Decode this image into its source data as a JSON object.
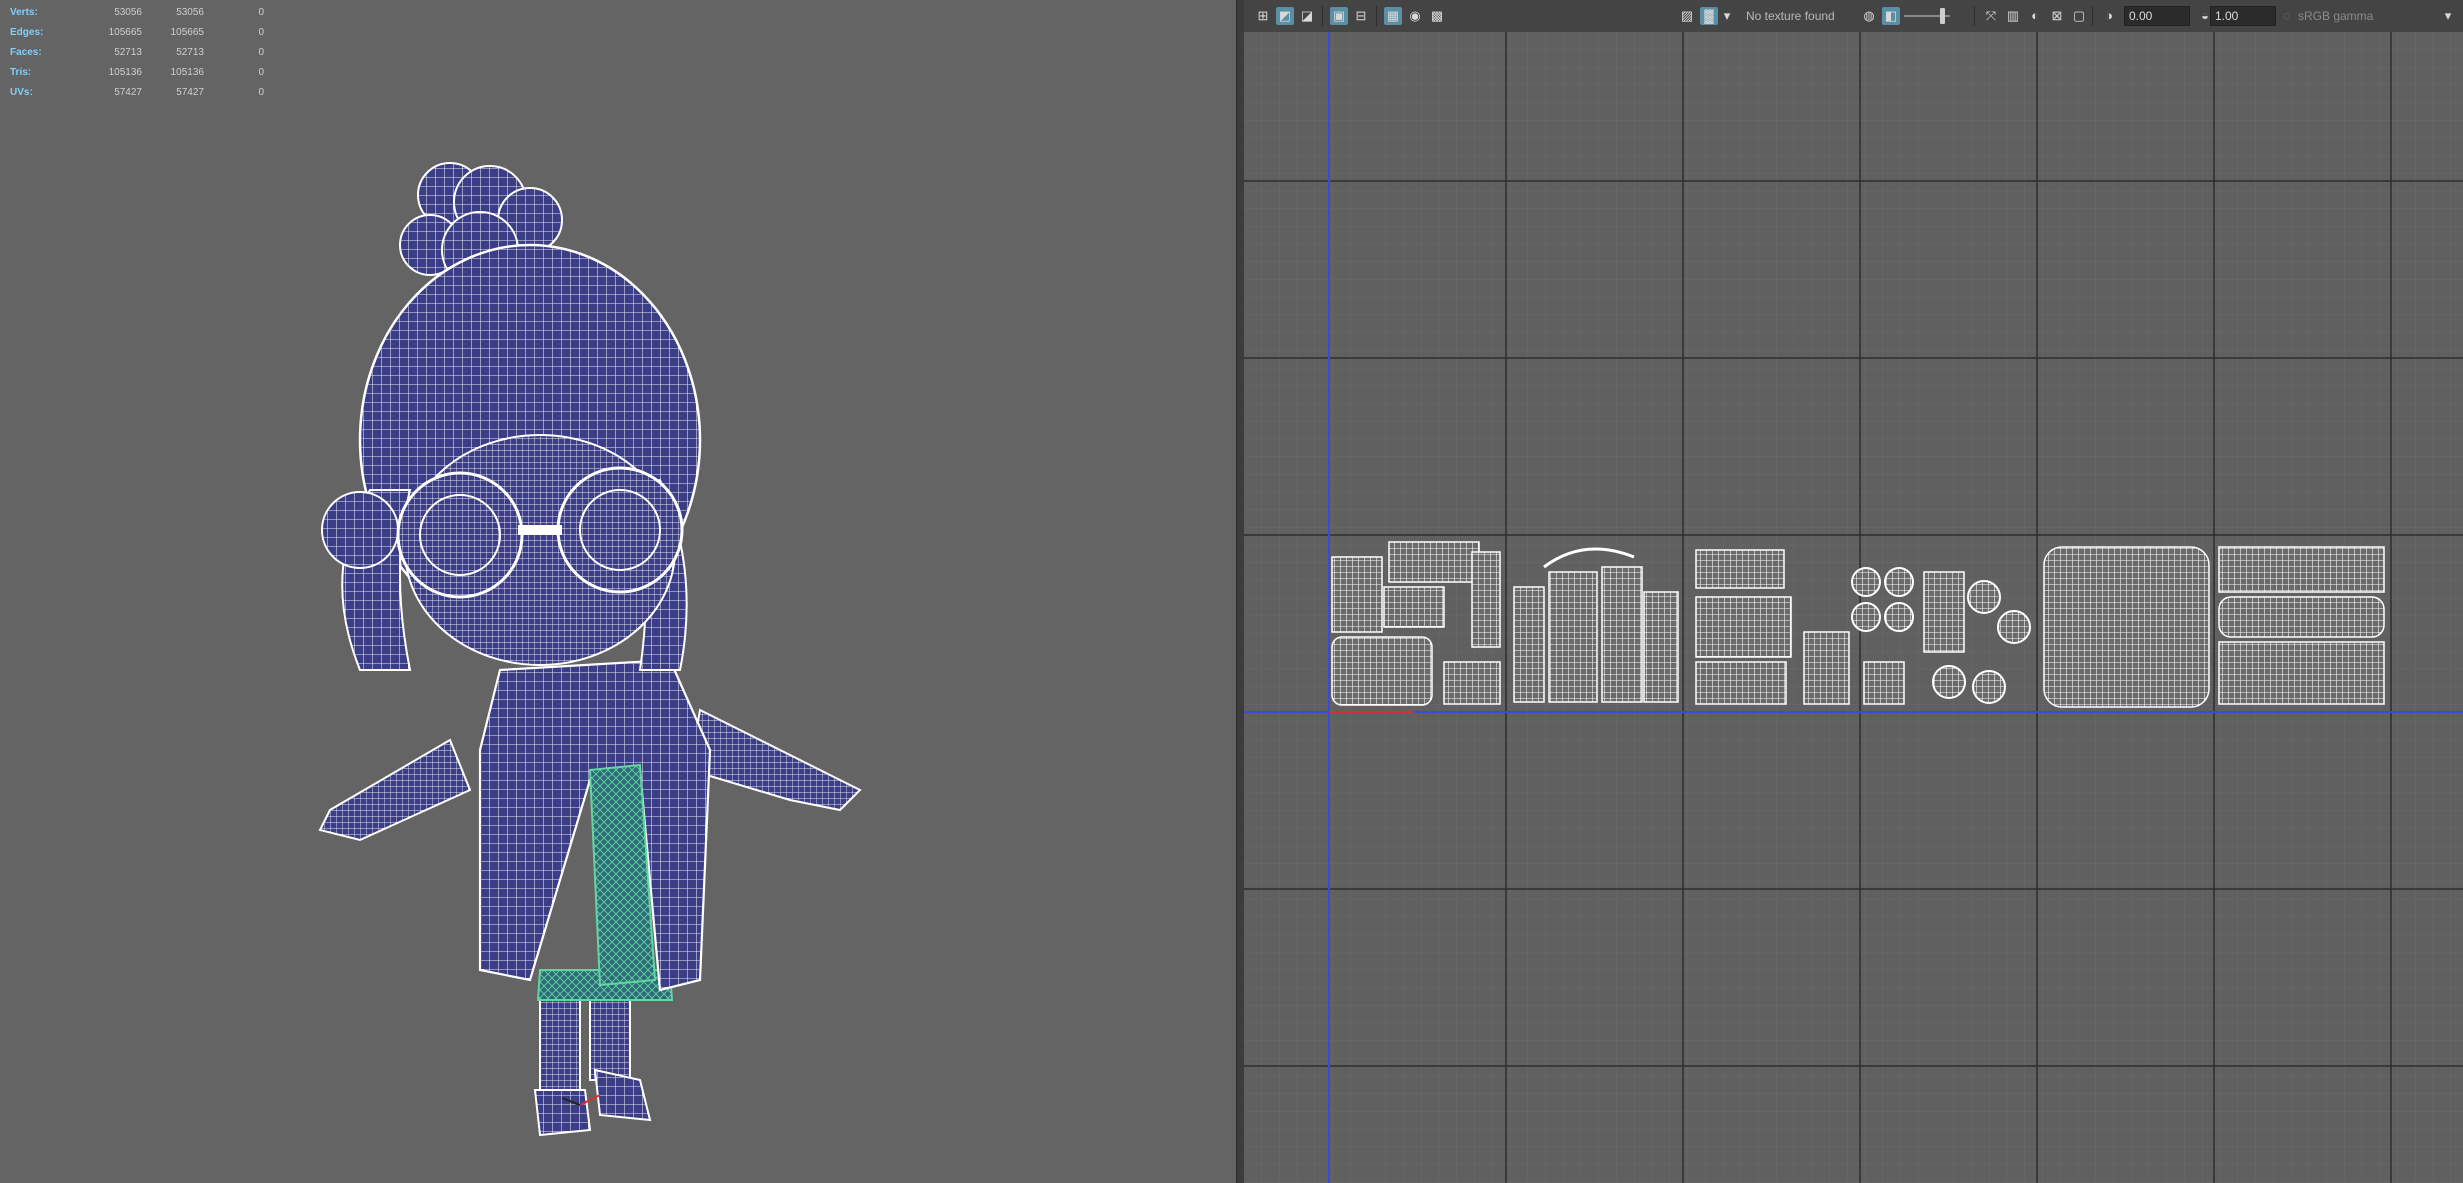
{
  "hud": {
    "rows": [
      {
        "label": "Verts:",
        "total": "53056",
        "selected": "53056",
        "extra": "0"
      },
      {
        "label": "Edges:",
        "total": "105665",
        "selected": "105665",
        "extra": "0"
      },
      {
        "label": "Faces:",
        "total": "52713",
        "selected": "52713",
        "extra": "0"
      },
      {
        "label": "Tris:",
        "total": "105136",
        "selected": "105136",
        "extra": "0"
      },
      {
        "label": "UVs:",
        "total": "57427",
        "selected": "57427",
        "extra": "0"
      }
    ]
  },
  "uv_toolbar": {
    "texture_status": "No texture found",
    "exposure_value": "0.00",
    "gamma_value": "1.00",
    "colorspace": "sRGB gamma"
  },
  "colors": {
    "hud_label": "#7fd0ff",
    "mesh_fill": "#3b3d86",
    "wire": "#ffffff",
    "selection_green": "#3fbf8a",
    "u_axis": "#3a4bd8",
    "v_axis": "#3a4bd8",
    "grid_major": "#2e2e2e",
    "origin_red": "#d83030"
  }
}
